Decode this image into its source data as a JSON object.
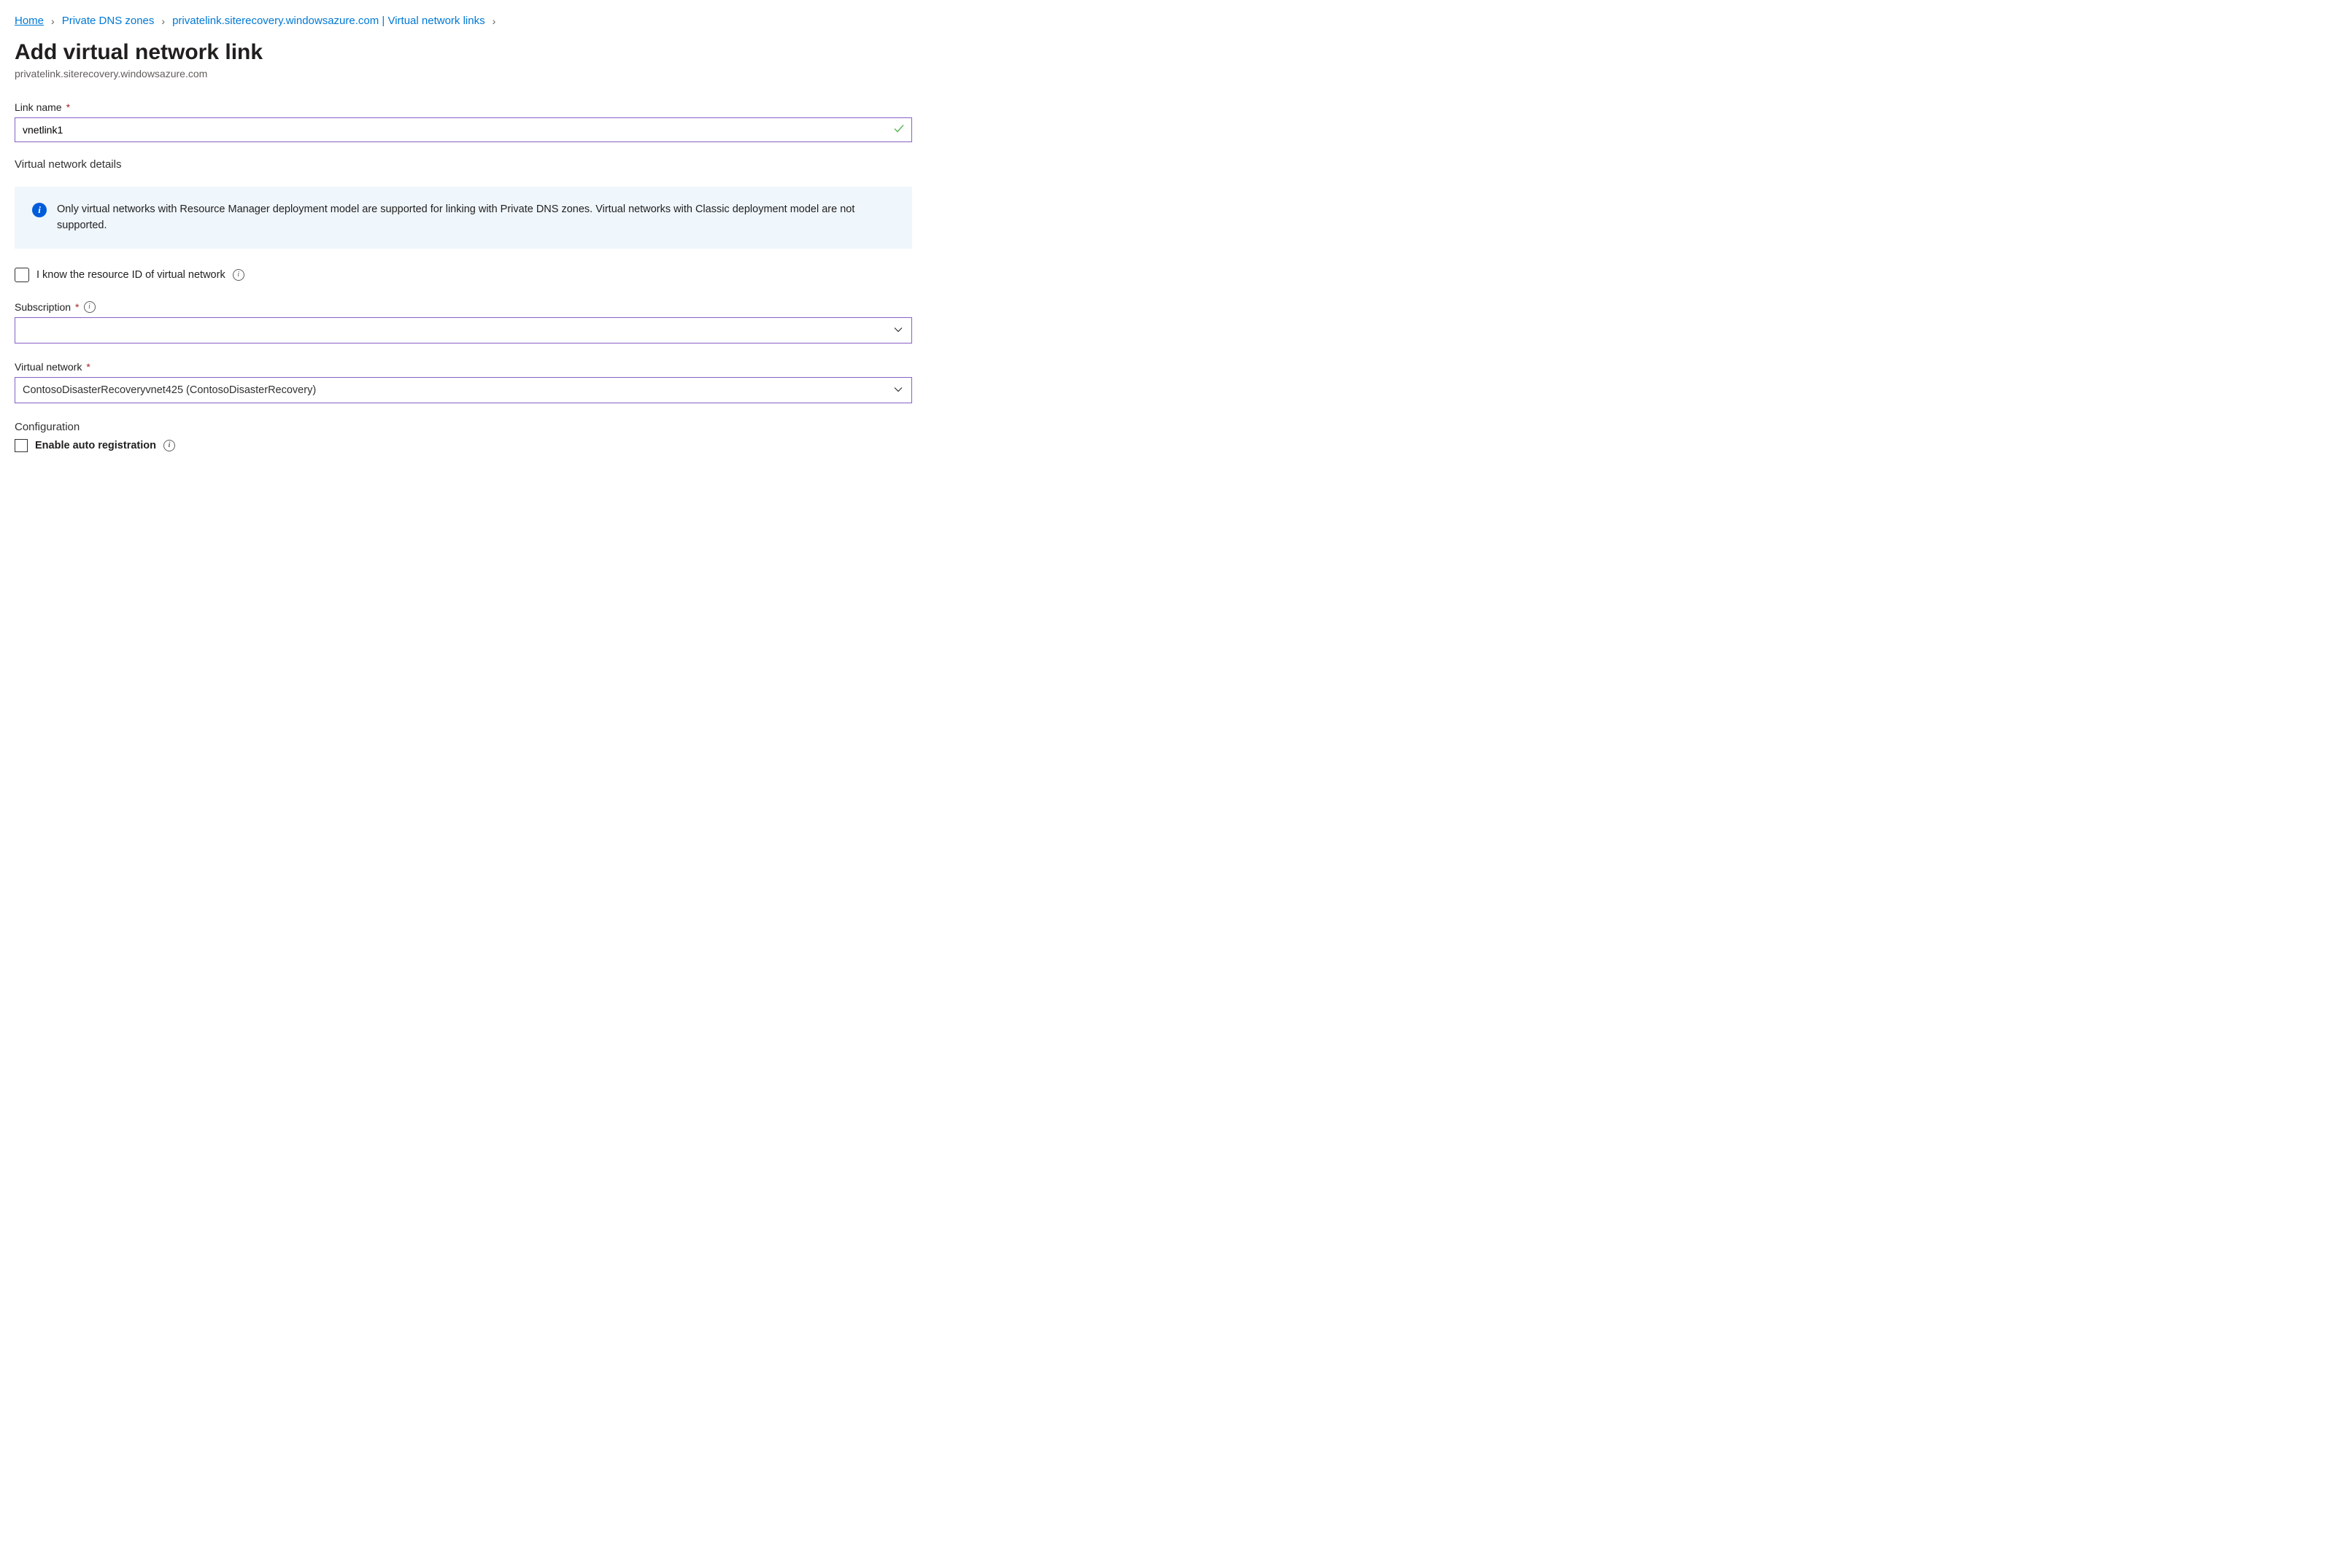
{
  "breadcrumb": {
    "items": [
      {
        "label": "Home",
        "underline": true
      },
      {
        "label": "Private DNS zones",
        "underline": false
      },
      {
        "label": "privatelink.siterecovery.windowsazure.com | Virtual network links",
        "underline": false
      }
    ]
  },
  "page": {
    "title": "Add virtual network link",
    "subtitle": "privatelink.siterecovery.windowsazure.com"
  },
  "form": {
    "link_name_label": "Link name",
    "link_name_value": "vnetlink1",
    "vnet_details_heading": "Virtual network details",
    "info_text": "Only virtual networks with Resource Manager deployment model are supported for linking with Private DNS zones. Virtual networks with Classic deployment model are not supported.",
    "resource_id_checkbox_label": "I know the resource ID of virtual network",
    "subscription_label": "Subscription",
    "subscription_value": "",
    "virtual_network_label": "Virtual network",
    "virtual_network_value": "ContosoDisasterRecoveryvnet425 (ContosoDisasterRecovery)",
    "configuration_heading": "Configuration",
    "enable_auto_reg_label": "Enable auto registration"
  }
}
